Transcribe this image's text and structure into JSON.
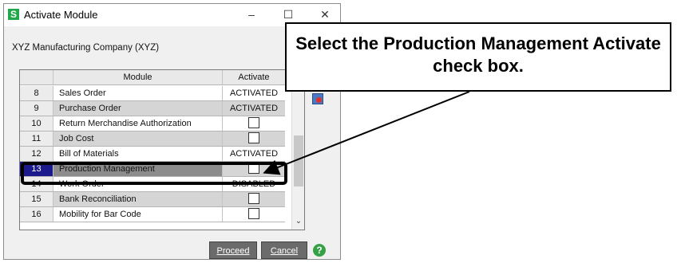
{
  "window": {
    "app_icon_letter": "S",
    "title": "Activate Module",
    "minimize": "–",
    "maximize": "☐",
    "close": "✕"
  },
  "company": "XYZ Manufacturing Company (XYZ)",
  "grid": {
    "headers": {
      "num": "",
      "module": "Module",
      "activate": "Activate"
    },
    "rows": [
      {
        "num": "8",
        "module": "Sales Order",
        "activate": "ACTIVATED"
      },
      {
        "num": "9",
        "module": "Purchase Order",
        "activate": "ACTIVATED"
      },
      {
        "num": "10",
        "module": "Return Merchandise Authorization",
        "activate": ""
      },
      {
        "num": "11",
        "module": "Job Cost",
        "activate": ""
      },
      {
        "num": "12",
        "module": "Bill of Materials",
        "activate": "ACTIVATED"
      },
      {
        "num": "13",
        "module": "Production Management",
        "activate": ""
      },
      {
        "num": "14",
        "module": "Work Order",
        "activate": "DISABLED"
      },
      {
        "num": "15",
        "module": "Bank Reconciliation",
        "activate": ""
      },
      {
        "num": "16",
        "module": "Mobility for Bar Code",
        "activate": ""
      }
    ],
    "scroll_down_arrow": "⌄"
  },
  "buttons": {
    "proceed": "Proceed",
    "cancel": "Cancel",
    "help": "?"
  },
  "callout": "Select the Production Management Activate check box.",
  "colors": {
    "app_icon": "#20a84a",
    "selected_row_number": "#1a1a8c",
    "help_icon": "#35a046"
  }
}
